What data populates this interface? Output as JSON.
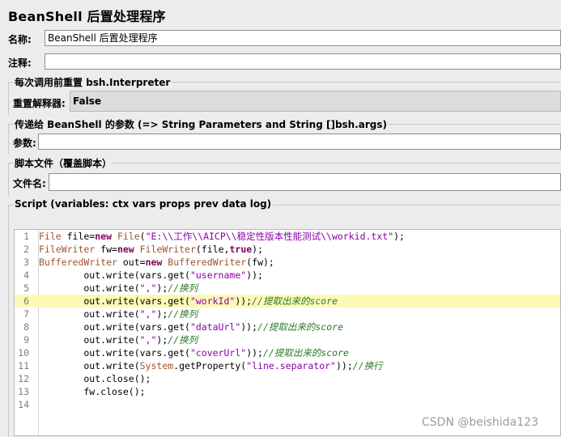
{
  "title": "BeanShell 后置处理程序",
  "name_label": "名称:",
  "name_value": "BeanShell 后置处理程序",
  "comment_label": "注释:",
  "comment_value": "",
  "reset_group": {
    "title": "每次调用前重置 bsh.Interpreter",
    "label": "重置解释器:",
    "value": "False"
  },
  "params_group": {
    "title": "传递给 BeanShell 的参数 (=> String Parameters and String []bsh.args)",
    "label": "参数:",
    "value": ""
  },
  "script_file_group": {
    "title": "脚本文件（覆盖脚本）",
    "label": "文件名:",
    "value": ""
  },
  "script_group": {
    "title": "Script (variables: ctx vars props prev data log)"
  },
  "code_lines": [
    "File file=new File(\"E:\\\\工作\\\\AICP\\\\稳定性版本性能测试\\\\workid.txt\");",
    "FileWriter fw=new FileWriter(file,true);",
    "BufferedWriter out=new BufferedWriter(fw);",
    "        out.write(vars.get(\"username\"));",
    "        out.write(\",\");//换列",
    "        out.write(vars.get(\"workId\"));//提取出来的score",
    "        out.write(\",\");//换列",
    "        out.write(vars.get(\"dataUrl\"));//提取出来的score",
    "        out.write(\",\");//换列",
    "        out.write(vars.get(\"coverUrl\"));//提取出来的score",
    "        out.write(System.getProperty(\"line.separator\"));//换行",
    "        out.close();",
    "        fw.close();",
    ""
  ],
  "highlighted_line": 6,
  "watermark": "CSDN @beishida123"
}
